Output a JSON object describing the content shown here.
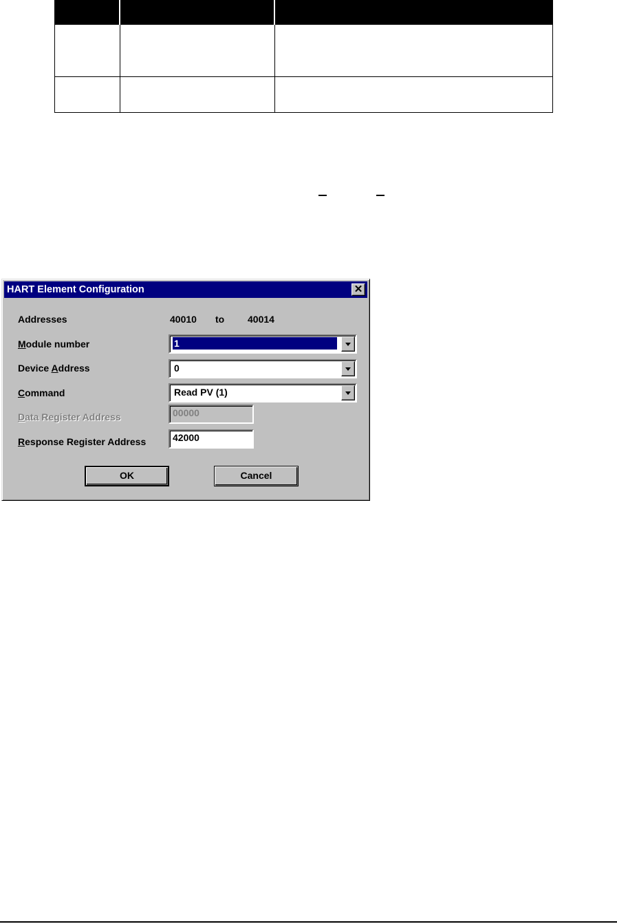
{
  "dialog": {
    "title": "HART Element Configuration",
    "close_glyph": "✕",
    "addresses": {
      "label": "Addresses",
      "start": "40010",
      "separator": "to",
      "end": "40014"
    },
    "module_number": {
      "label_mnemonic": "M",
      "label_rest": "odule number",
      "value": "1"
    },
    "device_address": {
      "label_prefix": "Device ",
      "label_mnemonic": "A",
      "label_rest": "ddress",
      "value": "0"
    },
    "command": {
      "label_mnemonic": "C",
      "label_rest": "ommand",
      "value": "Read PV (1)"
    },
    "data_register": {
      "label_mnemonic": "D",
      "label_rest": "ata Register Address",
      "value": "00000"
    },
    "response_register": {
      "label_mnemonic": "R",
      "label_rest": "esponse Register Address",
      "value": "42000"
    },
    "buttons": {
      "ok": "OK",
      "cancel": "Cancel"
    }
  }
}
